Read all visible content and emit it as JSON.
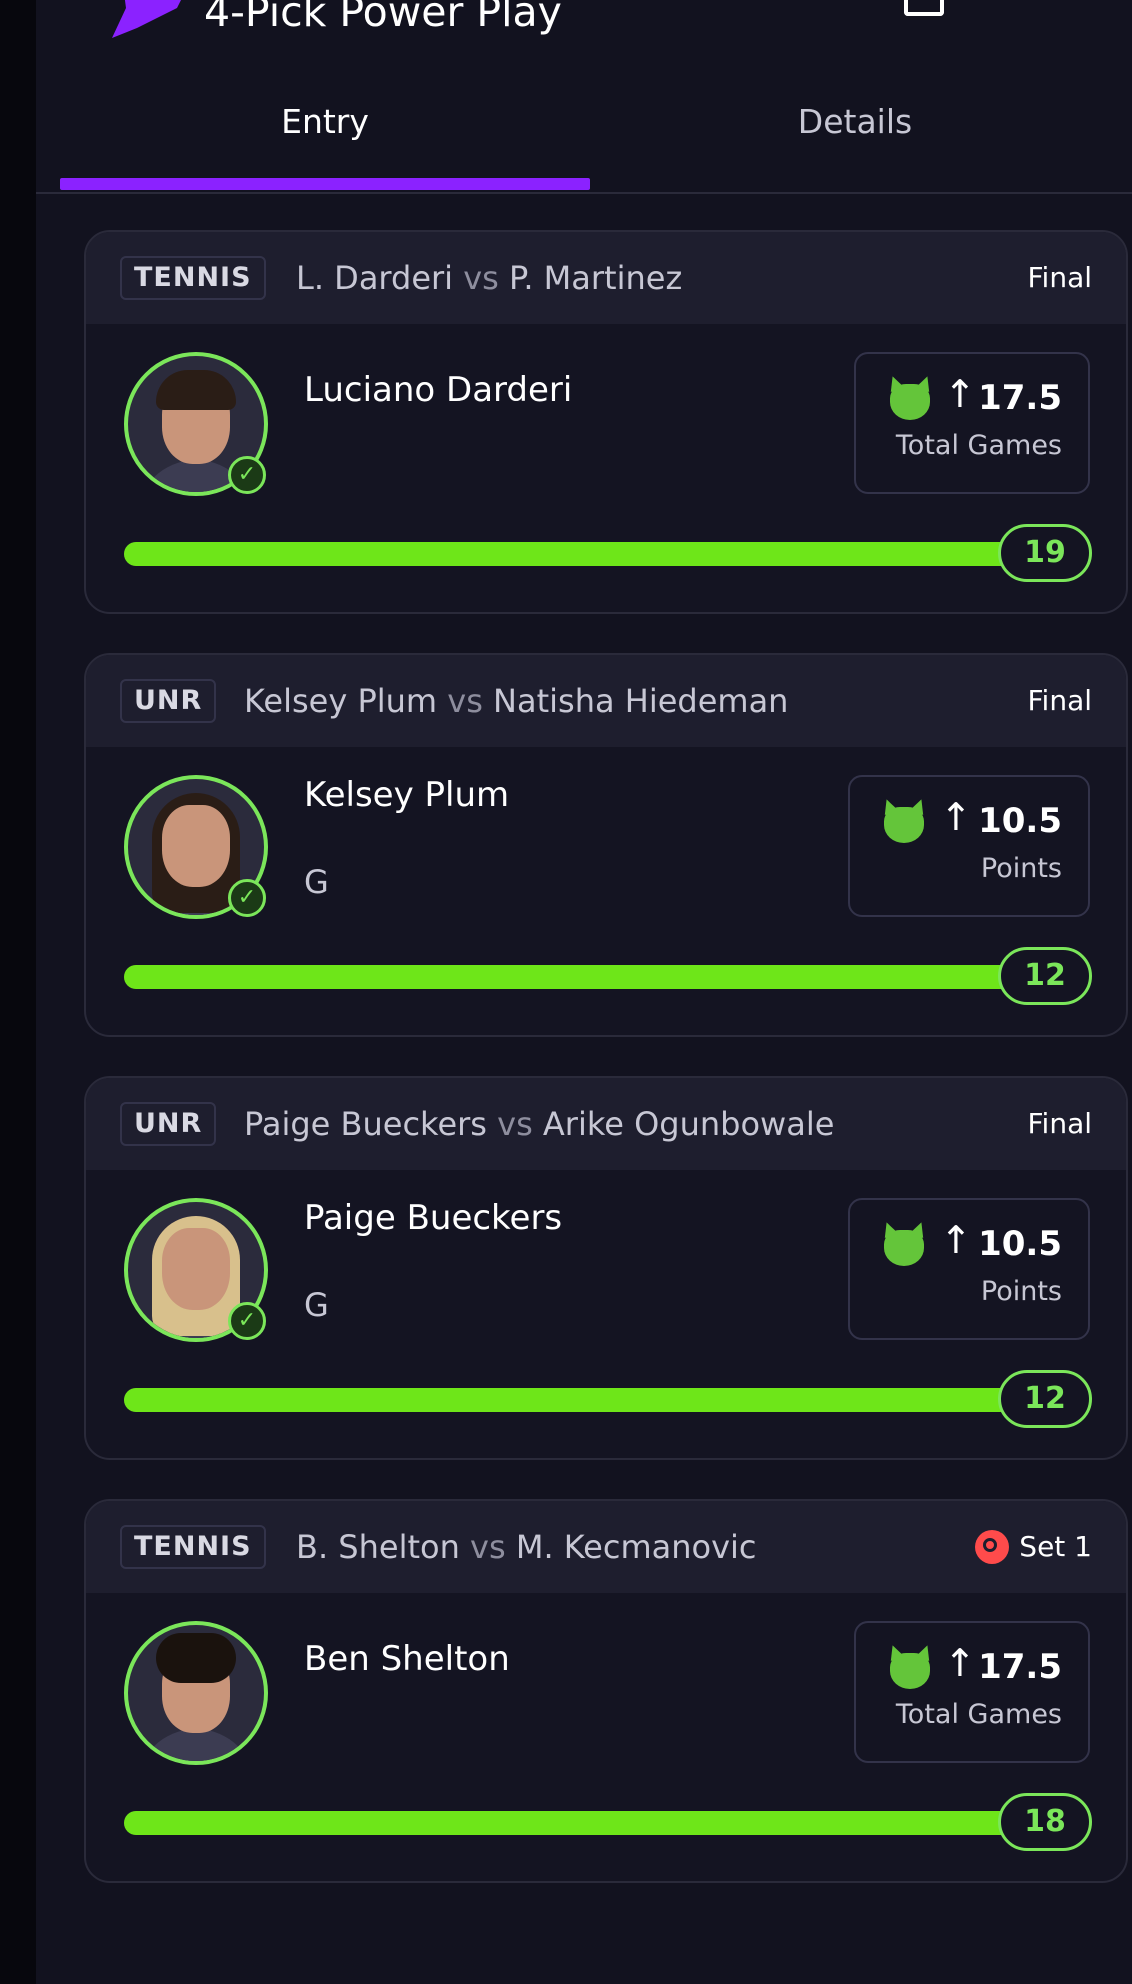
{
  "header": {
    "title": "4-Pick Power Play"
  },
  "tabs": [
    {
      "label": "Entry",
      "active": true
    },
    {
      "label": "Details",
      "active": false
    }
  ],
  "colors": {
    "accent": "#8b22ff",
    "success": "#7be65a",
    "progress": "#6ee619",
    "live": "#ff4b4b"
  },
  "picks": [
    {
      "league": "TENNIS",
      "team1": "L. Darderi",
      "vs": "vs",
      "team2": "P. Martinez",
      "status": "Final",
      "player": "Luciano Darderi",
      "position": "",
      "direction": "↑",
      "line": "17.5",
      "stat": "Total Games",
      "result": "19",
      "progress_fraction": 1.0,
      "checked": true,
      "icon": "demon-icon"
    },
    {
      "league": "UNR",
      "team1": "Kelsey Plum",
      "vs": "vs",
      "team2": "Natisha Hiedeman",
      "status": "Final",
      "player": "Kelsey Plum",
      "position": "G",
      "direction": "↑",
      "line": "10.5",
      "stat": "Points",
      "result": "12",
      "progress_fraction": 1.0,
      "checked": true,
      "icon": "demon-icon"
    },
    {
      "league": "UNR",
      "team1": "Paige Bueckers",
      "vs": "vs",
      "team2": "Arike Ogunbowale",
      "status": "Final",
      "player": "Paige Bueckers",
      "position": "G",
      "direction": "↑",
      "line": "10.5",
      "stat": "Points",
      "result": "12",
      "progress_fraction": 1.0,
      "checked": true,
      "icon": "demon-icon"
    },
    {
      "league": "TENNIS",
      "team1": "B. Shelton",
      "vs": "vs",
      "team2": "M. Kecmanovic",
      "status": "Set 1",
      "player": "Ben Shelton",
      "position": "",
      "direction": "↑",
      "line": "17.5",
      "stat": "Total Games",
      "result": "18",
      "progress_fraction": 1.0,
      "checked": false,
      "live": true,
      "icon": "demon-icon"
    }
  ]
}
